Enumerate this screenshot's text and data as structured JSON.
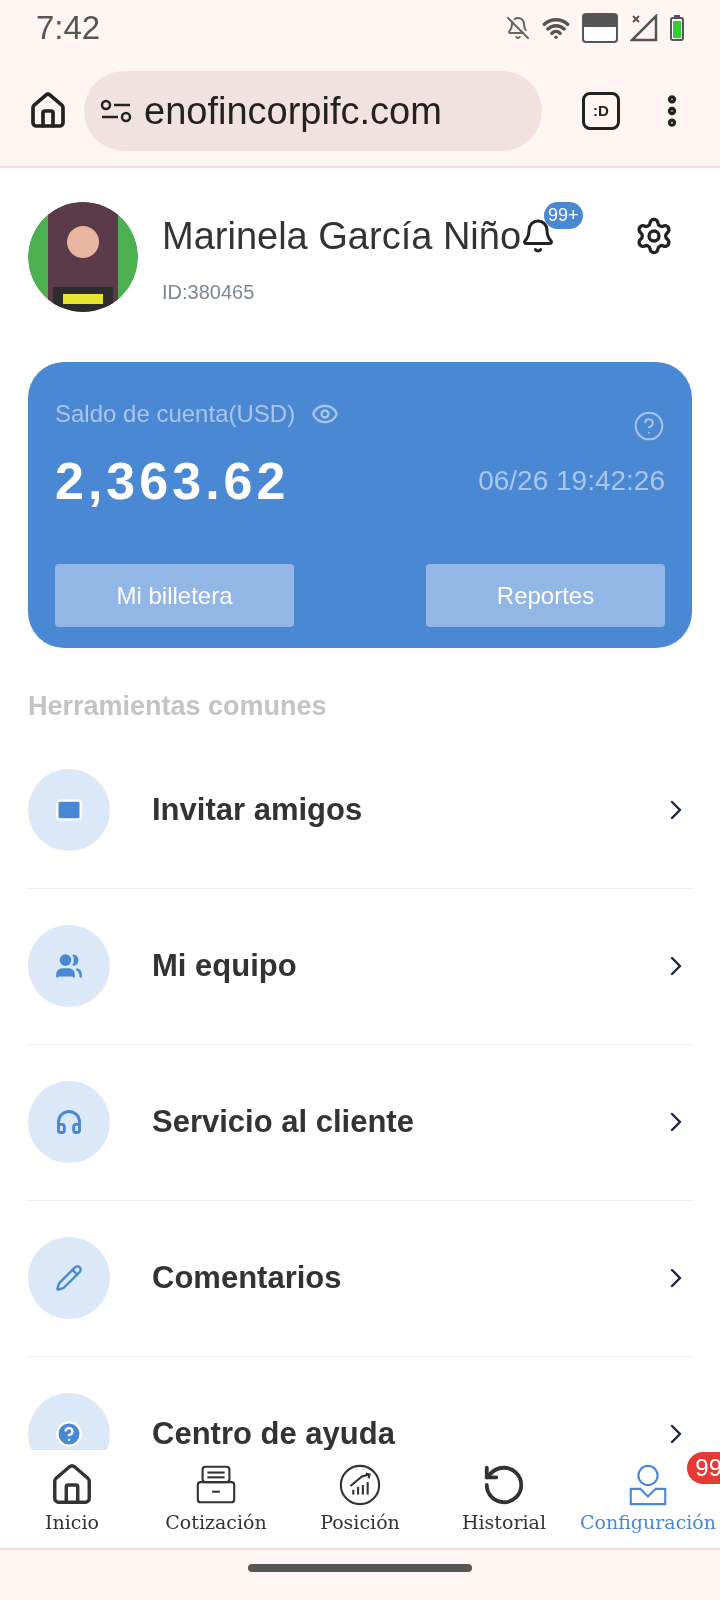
{
  "status_bar": {
    "time": "7:42"
  },
  "browser": {
    "url": "enofincorpifc.com",
    "tab_icon": ":D"
  },
  "profile": {
    "name": "Marinela García Niño",
    "id": "ID:380465",
    "notification_badge": "99+"
  },
  "account_card": {
    "label": "Saldo de cuenta(USD)",
    "balance": "2,363.62",
    "timestamp": "06/26 19:42:26",
    "buttons": [
      "Mi billetera",
      "Reportes"
    ]
  },
  "tools": {
    "title": "Herramientas comunes",
    "items": [
      {
        "kind": "invite",
        "label": "Invitar amigos"
      },
      {
        "kind": "team",
        "label": "Mi equipo"
      },
      {
        "kind": "support",
        "label": "Servicio al cliente"
      },
      {
        "kind": "feedback",
        "label": "Comentarios"
      },
      {
        "kind": "help",
        "label": "Centro de ayuda"
      }
    ]
  },
  "bottom_nav": [
    {
      "kind": "home",
      "label": "Inicio",
      "selected": false
    },
    {
      "kind": "quote",
      "label": "Cotización",
      "selected": false
    },
    {
      "kind": "position",
      "label": "Posición",
      "selected": false
    },
    {
      "kind": "history",
      "label": "Historial",
      "selected": false
    },
    {
      "kind": "settings",
      "label": "Configuración",
      "selected": true,
      "badge": "99"
    }
  ]
}
